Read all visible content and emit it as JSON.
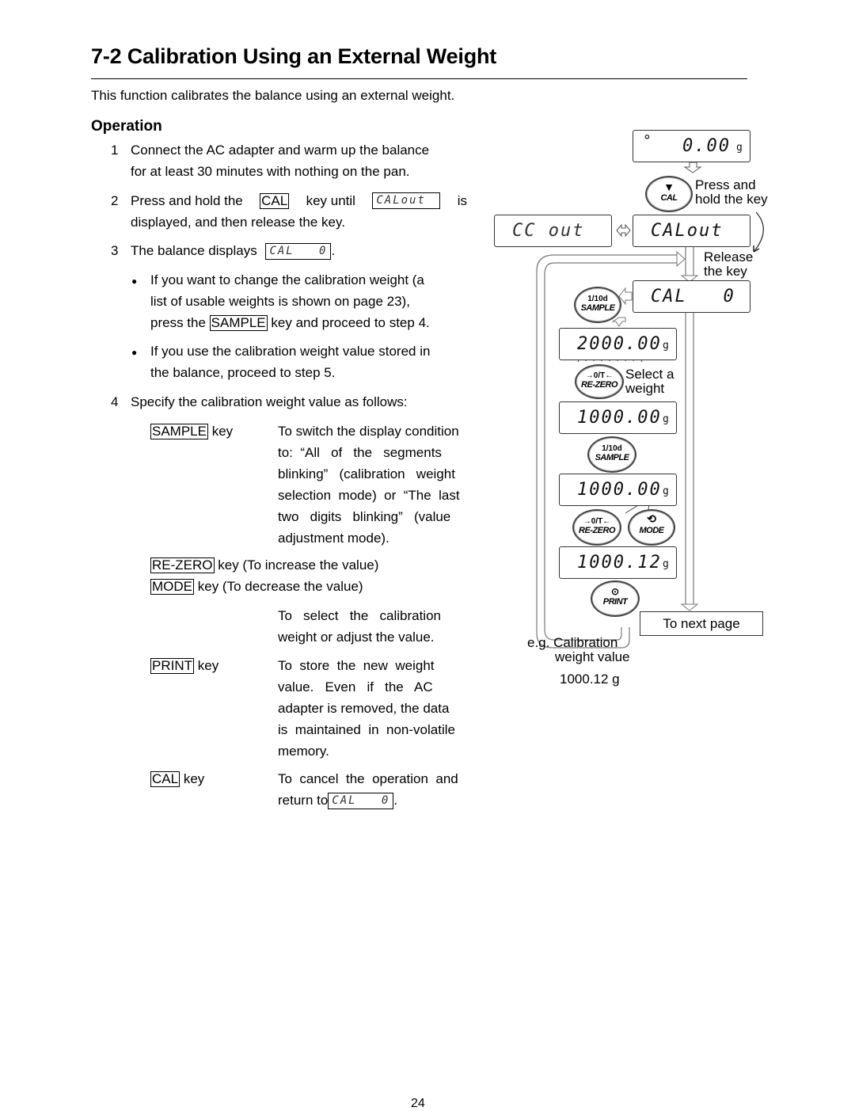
{
  "header": {
    "title": "7-2  Calibration Using an External Weight",
    "intro": "This function calibrates the balance using an external weight."
  },
  "operation": {
    "heading": "Operation",
    "steps": [
      {
        "num": "1",
        "line1": "Connect the AC adapter and warm up the balance",
        "line2": "for at least 30 minutes with nothing on the pan."
      },
      {
        "num": "2",
        "pre": "Press and hold the",
        "key": "CAL",
        "mid": "key until",
        "display": "CALout",
        "post": "is",
        "line2": "displayed, and then release the key."
      },
      {
        "num": "3",
        "pre": "The balance displays",
        "display": "CAL   0",
        "post": "."
      },
      {
        "num": "4",
        "text": "Specify the calibration weight value as follows:"
      }
    ],
    "bullets": [
      {
        "lines": [
          "If you want to change the calibration weight (a",
          "list of usable weights is shown on page 23),"
        ],
        "pre": "press the",
        "key": "SAMPLE",
        "post": "key and proceed to step 4."
      },
      {
        "lines": [
          "If you use the calibration weight value stored in",
          "the balance, proceed to step 5."
        ]
      }
    ],
    "key_table": {
      "sample": {
        "key": "SAMPLE",
        "suffix": "key",
        "desc": [
          "To switch the display condition",
          "to:  “All   of   the   segments",
          "blinking”   (calibration   weight",
          "selection  mode)  or  “The  last",
          "two   digits   blinking”   (value",
          "adjustment mode)."
        ]
      },
      "rezero": {
        "key": "RE-ZERO",
        "suffix": "key (To increase the value)"
      },
      "mode": {
        "key": "MODE",
        "suffix": "key (To decrease the value)"
      },
      "select_desc": [
        "To   select   the   calibration",
        "weight or adjust the value."
      ],
      "print": {
        "key": "PRINT",
        "suffix": "key",
        "desc": [
          "To  store  the  new  weight",
          "value.   Even   if   the   AC",
          "adapter is removed, the data",
          "is  maintained  in  non-volatile",
          "memory."
        ]
      },
      "cal": {
        "key": "CAL",
        "suffix": "key",
        "desc1": "To  cancel  the  operation  and",
        "desc2_pre": "return to",
        "display": "CAL   0",
        "desc2_post": "."
      }
    }
  },
  "diagram": {
    "displays": {
      "zero": {
        "indicator": "°",
        "value": "0.00",
        "unit": "g"
      },
      "ccout": {
        "value": "CC out"
      },
      "calout": {
        "value": "CALout"
      },
      "cal0": {
        "value": "CAL   0"
      },
      "w2000": {
        "value": "2000.00",
        "unit": "g"
      },
      "w1000a": {
        "value": "1000.00",
        "unit": "g"
      },
      "w1000b": {
        "value": "1000.00",
        "unit": "g"
      },
      "w1000c": {
        "value": "1000.12",
        "unit": "g"
      }
    },
    "keys": {
      "cal": {
        "top": "▼",
        "bottom": "CAL"
      },
      "sample1": {
        "top": "1/10d",
        "bottom": "SAMPLE"
      },
      "rezero1": {
        "top": "→0/T←",
        "bottom": "RE-ZERO"
      },
      "sample2": {
        "top": "1/10d",
        "bottom": "SAMPLE"
      },
      "rezero2": {
        "top": "→0/T←",
        "bottom": "RE-ZERO"
      },
      "mode": {
        "top": "⟲",
        "bottom": "MODE"
      },
      "print": {
        "top": "⊙",
        "bottom": "PRINT"
      }
    },
    "labels": {
      "press_hold": [
        "Press and",
        "hold the key"
      ],
      "release": [
        "Release",
        "the key"
      ],
      "select": [
        "Select a",
        "weight"
      ],
      "next_page": "To next page",
      "example": [
        "e.g. Calibration",
        "weight value",
        "1000.12 g"
      ]
    }
  },
  "footer": {
    "page_number": "24"
  }
}
